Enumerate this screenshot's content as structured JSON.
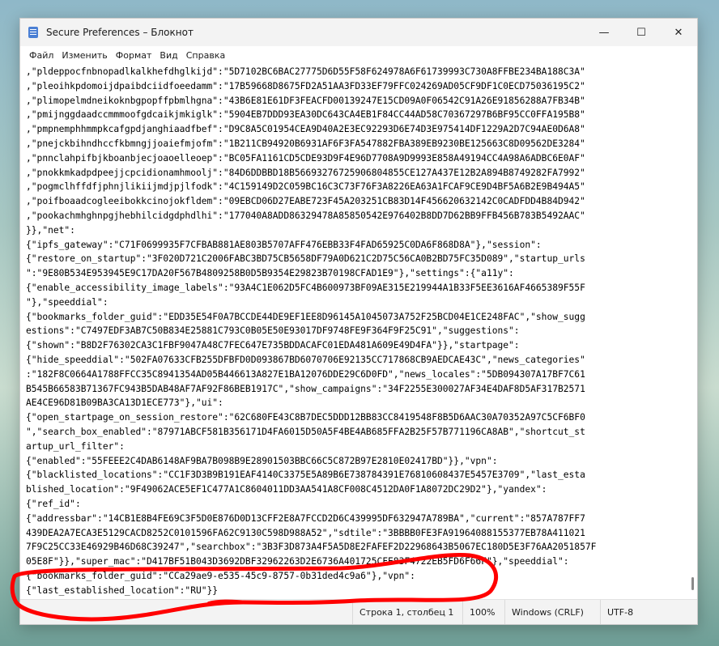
{
  "window": {
    "title": "Secure Preferences – Блокнот",
    "minimize_glyph": "—",
    "maximize_glyph": "☐",
    "close_glyph": "✕"
  },
  "menu": {
    "file": "Файл",
    "edit": "Изменить",
    "format": "Формат",
    "view": "Вид",
    "help": "Справка"
  },
  "document": {
    "lines": [
      ",\"pldeppocfnbnopadlkalkhefdhglkijd\":\"5D7102BC6BAC27775D6D55F58F624978A6F61739993C730A8FFBE234BA188C3A\"",
      ",\"pleoihkpdomoijdpaibdciidfoeedamm\":\"17B59668D8675FD2A51AA3FD33EF79FFC024269AD05CF9DF1C0ECD75036195C2\"",
      ",\"plimopelmdneikoknbgpopffpbmlhgna\":\"43B6E81E61DF3FEACFD00139247E15CD09A0F06542C91A26E91856288A7FB34B\"",
      ",\"pmijnggdaadccmmmoofgdcaikjmkiglk\":\"5904EB7DDD93EA30DC643CA4EB1F84CC44AD58C70367297B6BF95CC0FFA195B8\"",
      ",\"pmpnemphhmmpkcafgpdjanghiaadfbef\":\"D9C8A5C01954CEA9D40A2E3EC92293D6E74D3E975414DF1229A2D7C94AE0D6A8\"",
      ",\"pnejckbihndhccfkbmngjjoaiefmjofm\":\"1B211CB94920B6931AF6F3FA547882FBA389EB9230BE125663C8D09562DE3284\"",
      ",\"pnnclahpifbjkboanbjecjoaoelleoep\":\"BC05FA1161CD5CDE93D9F4E96D7708A9D9993E858A49194CC4A98A6ADBC6E0AF\"",
      ",\"pnokkmkadpdpeejjcpcidionamhmoolj\":\"84D6DDBBD18B5669327672590680485 5CE127A437E12B2A894B8749282FA7992\"",
      ",\"pogmclhffdfjphnjlikiijmdjpjlfodk\":\"4C159149D2C059BC16C3C73F76F3A8226EA63A1FCAF9CE9D4BF5A6B2E9B494A5\"",
      ",\"poifboaadcogleeibokkcinojokfldem\":\"09EBCD06D27EABE723F45A203251CB83D14F456620632142C0CADFDD4B84D942\"",
      ",\"pookachmhghnpgjhebhilcidgdphdlhi\":\"177040A8ADD86329478A85850542E976402B8DD7D62BB9FFB456B783B5492AAC\"",
      "}},\"net\":",
      "{\"ipfs_gateway\":\"C71F0699935F7CFBAB881AE803B5707AFF476EBB33F4FAD65925C0DA6F868D8A\"},\"session\":",
      "{\"restore_on_startup\":\"3F020D721C2006FABC3BD75CB5658DF79A0D621C2D75C56CA0B2BD75FC35D089\",\"startup_urls",
      "\":\"9E80B534E953945E9C17DA20F567B4809258B0D5B9354E29823B70198CFAD1E9\"},\"settings\":{\"a11y\":",
      "{\"enable_accessibility_image_labels\":\"93A4C1E062D5FC4B600973BF09AE315E219944A1B33F5EE3616AF4665389F55F",
      "\"},\"speeddial\":",
      "{\"bookmarks_folder_guid\":\"EDD35E54F0A7BCCDE44DE9EF1EE8D96145A1045073A752F25BCD04E1CE248FAC\",\"show_sugg",
      "estions\":\"C7497EDF3AB7C50B834E25881C793C0B05E50E93017DF9748FE9F364F9F25C91\",\"suggestions\":",
      "{\"shown\":\"B8D2F76302CA3C1FBF9047A48C7FEC647E735BDDACAFC01EDA481A609E49D4FA\"}},\"startpage\":",
      "{\"hide_speeddial\":\"502FA07633CFB255DFBFD0D093867BD6070706E92135CC717868CB9AEDCAE43C\",\"news_categories\"",
      ":\"182F8C0664A1788FFCC35C8941354AD05B446613A827E1BA12076DDE29C6D0FD\",\"news_locales\":\"5DB094307A17BF7C61",
      "B545B66583B71367FC943B5DAB48AF7AF92F86BEB1917C\",\"show_campaigns\":\"34F2255E300027AF34E4DAF8D5AF317B2571",
      "AE4CE96D81B09BA3CA13D1ECE773\"},\"ui\":",
      "{\"open_startpage_on_session_restore\":\"62C680FE43C8B7DEC5DDD12BB83CC8419548F8B5D6AAC30A70352A97C5CF6BF0",
      "\",\"search_box_enabled\":\"87971ABCF581B356171D4FA6015D50A5F4BE4AB685FFA2B25F57B771196CA8AB\",\"shortcut_st",
      "artup_url_filter\":",
      "{\"enabled\":\"55FEEE2C4DAB6148AF9BA7B098B9E28901503BBC66C5C872B97E2810E02417BD\"}},\"vpn\":",
      "{\"blacklisted_locations\":\"CC1F3D3B9B191EAF4140C3375E5A89B6E738784391E76810608437E5457E3709\",\"last_esta",
      "blished_location\":\"9F49062ACE5EF1C477A1C8604011DD3AA541A8CF008C4512DA0F1A8072DC29D2\"},\"yandex\":",
      "{\"ref_id\":",
      "{\"addressbar\":\"14CB1E8B4FE69C3F5D0E876D0D13CFF2E8A7FCCD2D6C439995DF632947A789BA\",\"current\":\"857A787FF7",
      "439DEA2A7ECA3E5129CACD8252C0101596FA62C9130C598D988A52\",\"sdtile\":\"3BBBB0FE3FA91964088155377EB78A411021",
      "7F9C25CC33E46929B46D68C39247\",\"searchbox\":\"3B3F3D873A4F5A5D8E2FAFEF2D22968643B5067EC180D5E3F76AA2051857F",
      "05E8F\"}},\"super_mac\":\"D417BF51B043D3692DBF32962263D2E6736A4017 25CFE83F4722EB5FD6F66F\"},\"speeddial\":",
      "{\"bookmarks_folder_guid\":\"CCa29ae9-e535-45c9-8757-0b31ded4c9a6\"},\"vpn\":",
      "{\"last_established_location\":\"RU\"}}"
    ]
  },
  "status": {
    "position": "Строка 1, столбец 1",
    "zoom": "100%",
    "line_ending": "Windows (CRLF)",
    "encoding": "UTF-8"
  },
  "colors": {
    "annotation": "#ff0000"
  }
}
